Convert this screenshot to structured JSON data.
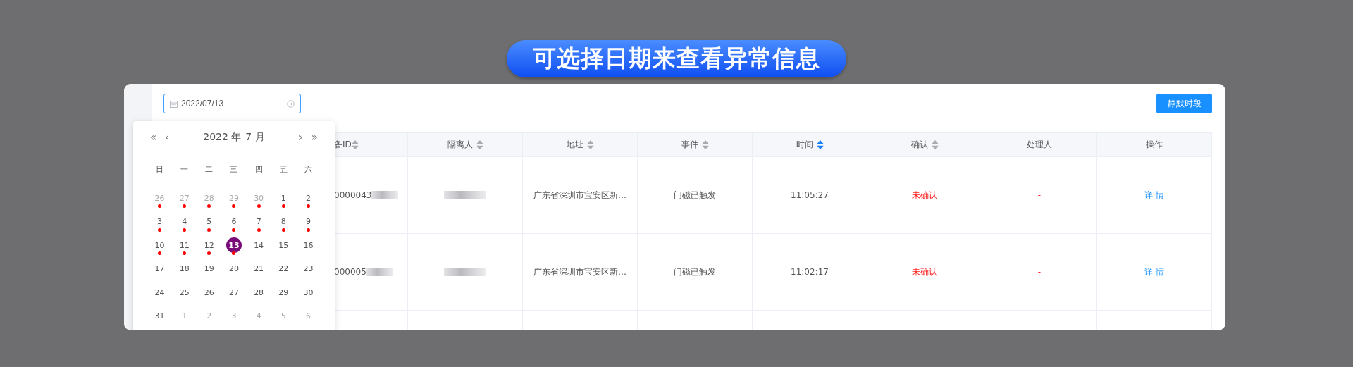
{
  "banner": {
    "title": "可选择日期来查看异常信息"
  },
  "toolbar": {
    "date_field": {
      "value": "2022/07/13",
      "focused": true
    },
    "button": "静默时段"
  },
  "calendar": {
    "year_label": "2022 年",
    "month_label": "7 月",
    "nav": [
      "«",
      "‹",
      "›",
      "»"
    ],
    "weekdays": [
      "日",
      "一",
      "二",
      "三",
      "四",
      "五",
      "六"
    ],
    "days": [
      {
        "label": "26",
        "other_month": true,
        "marked": true,
        "selected": false
      },
      {
        "label": "27",
        "other_month": true,
        "marked": true,
        "selected": false
      },
      {
        "label": "28",
        "other_month": true,
        "marked": true,
        "selected": false
      },
      {
        "label": "29",
        "other_month": true,
        "marked": true,
        "selected": false
      },
      {
        "label": "30",
        "other_month": true,
        "marked": true,
        "selected": false
      },
      {
        "label": "1",
        "other_month": false,
        "marked": true,
        "selected": false
      },
      {
        "label": "2",
        "other_month": false,
        "marked": true,
        "selected": false
      },
      {
        "label": "3",
        "other_month": false,
        "marked": true,
        "selected": false
      },
      {
        "label": "4",
        "other_month": false,
        "marked": true,
        "selected": false
      },
      {
        "label": "5",
        "other_month": false,
        "marked": true,
        "selected": false
      },
      {
        "label": "6",
        "other_month": false,
        "marked": true,
        "selected": false
      },
      {
        "label": "7",
        "other_month": false,
        "marked": true,
        "selected": false
      },
      {
        "label": "8",
        "other_month": false,
        "marked": true,
        "selected": false
      },
      {
        "label": "9",
        "other_month": false,
        "marked": true,
        "selected": false
      },
      {
        "label": "10",
        "other_month": false,
        "marked": true,
        "selected": false
      },
      {
        "label": "11",
        "other_month": false,
        "marked": true,
        "selected": false
      },
      {
        "label": "12",
        "other_month": false,
        "marked": true,
        "selected": false
      },
      {
        "label": "13",
        "other_month": false,
        "marked": true,
        "selected": true
      },
      {
        "label": "14",
        "other_month": false,
        "marked": false,
        "selected": false
      },
      {
        "label": "15",
        "other_month": false,
        "marked": false,
        "selected": false
      },
      {
        "label": "16",
        "other_month": false,
        "marked": false,
        "selected": false
      },
      {
        "label": "17",
        "other_month": false,
        "marked": false,
        "selected": false
      },
      {
        "label": "18",
        "other_month": false,
        "marked": false,
        "selected": false
      },
      {
        "label": "19",
        "other_month": false,
        "marked": false,
        "selected": false
      },
      {
        "label": "20",
        "other_month": false,
        "marked": false,
        "selected": false
      },
      {
        "label": "21",
        "other_month": false,
        "marked": false,
        "selected": false
      },
      {
        "label": "22",
        "other_month": false,
        "marked": false,
        "selected": false
      },
      {
        "label": "23",
        "other_month": false,
        "marked": false,
        "selected": false
      },
      {
        "label": "24",
        "other_month": false,
        "marked": false,
        "selected": false
      },
      {
        "label": "25",
        "other_month": false,
        "marked": false,
        "selected": false
      },
      {
        "label": "26",
        "other_month": false,
        "marked": false,
        "selected": false
      },
      {
        "label": "27",
        "other_month": false,
        "marked": false,
        "selected": false
      },
      {
        "label": "28",
        "other_month": false,
        "marked": false,
        "selected": false
      },
      {
        "label": "29",
        "other_month": false,
        "marked": false,
        "selected": false
      },
      {
        "label": "30",
        "other_month": false,
        "marked": false,
        "selected": false
      },
      {
        "label": "31",
        "other_month": false,
        "marked": false,
        "selected": false
      },
      {
        "label": "1",
        "other_month": true,
        "marked": false,
        "selected": false
      },
      {
        "label": "2",
        "other_month": true,
        "marked": false,
        "selected": false
      },
      {
        "label": "3",
        "other_month": true,
        "marked": false,
        "selected": false
      },
      {
        "label": "4",
        "other_month": true,
        "marked": false,
        "selected": false
      },
      {
        "label": "5",
        "other_month": true,
        "marked": false,
        "selected": false
      },
      {
        "label": "6",
        "other_month": true,
        "marked": false,
        "selected": false
      }
    ]
  },
  "table": {
    "columns": [
      {
        "label": "备ID",
        "sortable": true,
        "sort_active": false
      },
      {
        "label": "隔离人",
        "sortable": true,
        "sort_active": false
      },
      {
        "label": "地址",
        "sortable": true,
        "sort_active": false
      },
      {
        "label": "事件",
        "sortable": true,
        "sort_active": false
      },
      {
        "label": "时间",
        "sortable": true,
        "sort_active": true
      },
      {
        "label": "确认",
        "sortable": true,
        "sort_active": false
      },
      {
        "label": "处理人",
        "sortable": false
      },
      {
        "label": "操作",
        "sortable": false
      }
    ],
    "rows": [
      {
        "cells": [
          {
            "kind": "id",
            "text": "0000043",
            "blurred_suffix": true
          },
          {
            "kind": "redacted"
          },
          {
            "kind": "text",
            "text": "广东省深圳市宝安区新…"
          },
          {
            "kind": "text",
            "text": "门磁已触发"
          },
          {
            "kind": "text",
            "text": "11:05:27"
          },
          {
            "kind": "alert",
            "text": "未确认"
          },
          {
            "kind": "alert",
            "text": "-"
          },
          {
            "kind": "link",
            "text": "详 情"
          }
        ]
      },
      {
        "cells": [
          {
            "kind": "id",
            "text": "000005",
            "blurred_suffix": true
          },
          {
            "kind": "redacted"
          },
          {
            "kind": "text",
            "text": "广东省深圳市宝安区新…"
          },
          {
            "kind": "text",
            "text": "门磁已触发"
          },
          {
            "kind": "text",
            "text": "11:02:17"
          },
          {
            "kind": "alert",
            "text": "未确认"
          },
          {
            "kind": "alert",
            "text": "-"
          },
          {
            "kind": "link",
            "text": "详 情"
          }
        ]
      }
    ]
  }
}
